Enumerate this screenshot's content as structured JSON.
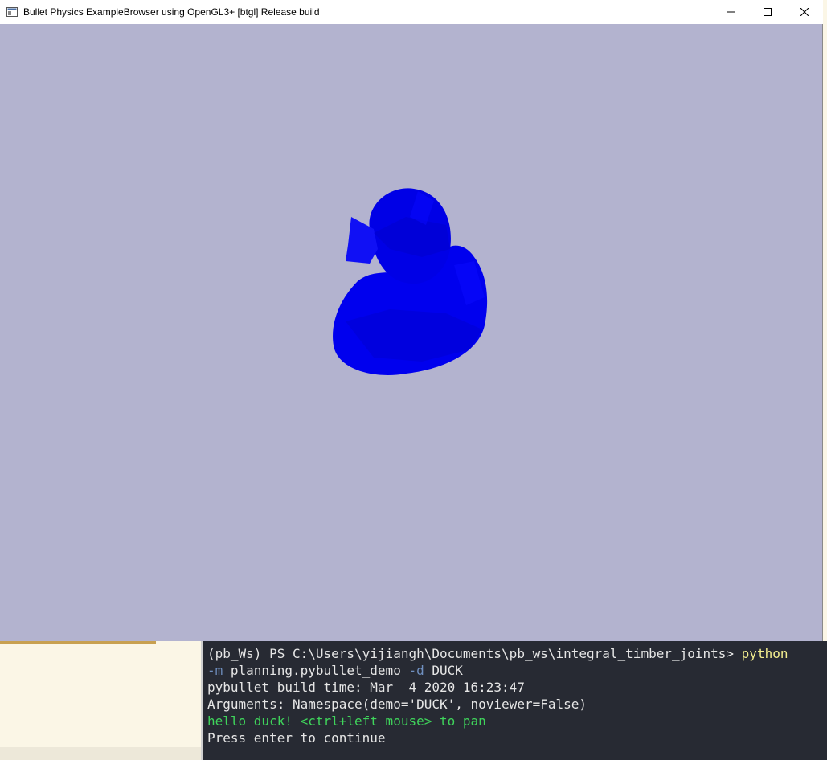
{
  "window": {
    "title": "Bullet Physics ExampleBrowser using OpenGL3+ [btgl] Release build",
    "minimize_icon": "minimize-icon",
    "maximize_icon": "maximize-icon",
    "close_icon": "close-icon"
  },
  "scene": {
    "background_color": "#b3b3cf",
    "object_color": "#0000ee",
    "object": "duck-model"
  },
  "terminal": {
    "prompt": "(pb_Ws) PS C:\\Users\\yijiangh\\Documents\\pb_ws\\integral_timber_joints> ",
    "cmd": "python",
    "flag_m": "-m",
    "module": " planning.pybullet_demo ",
    "flag_d": "-d",
    "demo_arg": " DUCK",
    "build_time": "pybullet build time: Mar  4 2020 16:23:47",
    "arguments": "Arguments: Namespace(demo='DUCK', noviewer=False)",
    "hello": "hello duck! <ctrl+left mouse> to pan",
    "press_enter": "Press enter to continue"
  }
}
